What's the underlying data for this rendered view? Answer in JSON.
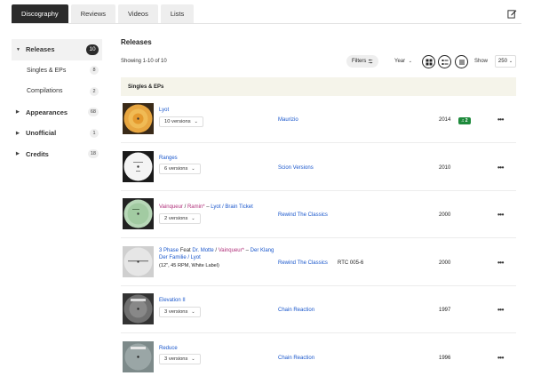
{
  "tabs": [
    {
      "label": "Discography",
      "active": true
    },
    {
      "label": "Reviews"
    },
    {
      "label": "Videos"
    },
    {
      "label": "Lists"
    }
  ],
  "edit_icon": "edit-icon",
  "sidebar": {
    "items": [
      {
        "label": "Releases",
        "count": "10",
        "arrow": "▼"
      },
      {
        "label": "Singles & EPs",
        "count": "8"
      },
      {
        "label": "Compilations",
        "count": "2"
      },
      {
        "label": "Appearances",
        "count": "68",
        "arrow": "▶"
      },
      {
        "label": "Unofficial",
        "count": "1",
        "arrow": "▶"
      },
      {
        "label": "Credits",
        "count": "18",
        "arrow": "▶"
      }
    ]
  },
  "main": {
    "title": "Releases",
    "showing": "Showing 1-10 of 10",
    "filters_label": "Filters",
    "year_label": "Year",
    "show_label": "Show",
    "show_value": "250",
    "section_title": "Singles & EPs"
  },
  "rows": [
    {
      "title_parts": [
        {
          "t": "Lyot",
          "c": "link"
        }
      ],
      "versions": "10 versions",
      "label": "Maurizio",
      "catno": "",
      "year": "2014",
      "badge": "2",
      "cover": "orange"
    },
    {
      "title_parts": [
        {
          "t": "Ranges",
          "c": "link"
        }
      ],
      "versions": "6 versions",
      "label": "Scion Versions",
      "catno": "",
      "year": "2010",
      "cover": "white"
    },
    {
      "title_parts": [
        {
          "t": "Vainqueur",
          "c": "pink"
        },
        {
          "t": " / ",
          "c": "sep"
        },
        {
          "t": "Ramin*",
          "c": "pink"
        },
        {
          "t": " – ",
          "c": "sep"
        },
        {
          "t": "Lyot / Brain Ticket",
          "c": "link"
        }
      ],
      "versions": "2 versions",
      "label": "Rewind The Classics",
      "catno": "",
      "year": "2000",
      "cover": "green"
    },
    {
      "title_parts": [
        {
          "t": "3 Phase",
          "c": "link"
        },
        {
          "t": " Feat ",
          "c": "sep"
        },
        {
          "t": "Dr. Motte",
          "c": "link"
        },
        {
          "t": " / ",
          "c": "sep"
        },
        {
          "t": "Vainqueur*",
          "c": "pink"
        },
        {
          "t": " – ",
          "c": "sep"
        },
        {
          "t": "Der Klang Der Familie / Lyot",
          "c": "link"
        }
      ],
      "subtitle": "(12\", 45 RPM, White Label)",
      "versions": "",
      "label": "Rewind The Classics",
      "catno": "RTC 005-6",
      "year": "2000",
      "cover": "whitelabel"
    },
    {
      "title_parts": [
        {
          "t": "Elevation II",
          "c": "link"
        }
      ],
      "versions": "3 versions",
      "label": "Chain Reaction",
      "catno": "",
      "year": "1997",
      "cover": "grey"
    },
    {
      "title_parts": [
        {
          "t": "Reduce",
          "c": "link"
        }
      ],
      "versions": "3 versions",
      "label": "Chain Reaction",
      "catno": "",
      "year": "1996",
      "cover": "grey2"
    }
  ]
}
